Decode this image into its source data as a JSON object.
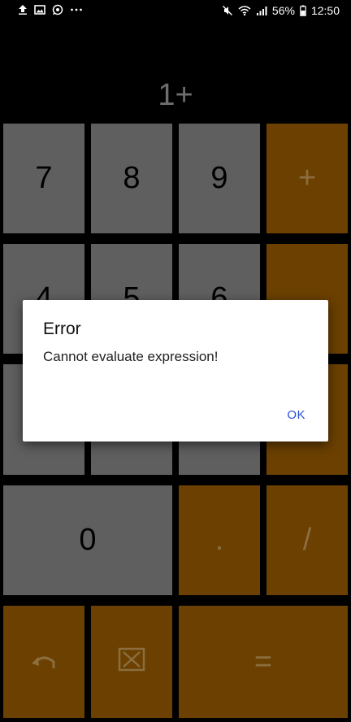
{
  "status_bar": {
    "left_icons": [
      "upload-icon",
      "image-icon",
      "whatsapp-icon",
      "more-dots-icon"
    ],
    "right_icons": [
      "mute-icon",
      "wifi-icon",
      "signal-icon",
      "battery-icon"
    ],
    "battery": "56%",
    "time": "12:50"
  },
  "display": {
    "expression": "1+"
  },
  "keypad": {
    "k7": "7",
    "k8": "8",
    "k9": "9",
    "plus": "+",
    "k4": "4",
    "k5": "5",
    "k6": "6",
    "k0": "0",
    "dot": ".",
    "divide": "/",
    "equals": "="
  },
  "colors": {
    "number_key": "#5f5f5f",
    "operator_key": "#6b4000",
    "dialog_button": "#2b50d6"
  },
  "dialog": {
    "title": "Error",
    "message": "Cannot evaluate expression!",
    "ok_label": "OK"
  }
}
